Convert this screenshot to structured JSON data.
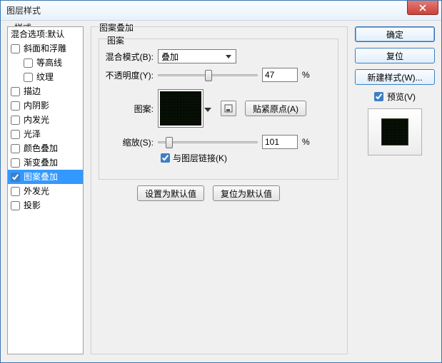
{
  "window": {
    "title": "图层样式"
  },
  "styles": {
    "panel_title": "样式",
    "blend_options": "混合选项:默认",
    "items": [
      {
        "label": "斜面和浮雕",
        "checked": false
      },
      {
        "label": "等高线",
        "checked": false,
        "indent": true
      },
      {
        "label": "纹理",
        "checked": false,
        "indent": true
      },
      {
        "label": "描边",
        "checked": false
      },
      {
        "label": "内阴影",
        "checked": false
      },
      {
        "label": "内发光",
        "checked": false
      },
      {
        "label": "光泽",
        "checked": false
      },
      {
        "label": "颜色叠加",
        "checked": false
      },
      {
        "label": "渐变叠加",
        "checked": false
      },
      {
        "label": "图案叠加",
        "checked": true,
        "selected": true
      },
      {
        "label": "外发光",
        "checked": false
      },
      {
        "label": "投影",
        "checked": false
      }
    ]
  },
  "center": {
    "group_title": "图案叠加",
    "inner_title": "图案",
    "blend_mode_label": "混合模式(B):",
    "blend_mode_value": "叠加",
    "opacity_label": "不透明度(Y):",
    "opacity_value": "47",
    "pattern_label": "图案:",
    "snap_origin_label": "贴紧原点(A)",
    "scale_label": "缩放(S):",
    "scale_value": "101",
    "link_label": "与图层链接(K)",
    "link_checked": true,
    "set_default": "设置为默认值",
    "reset_default": "复位为默认值",
    "percent": "%"
  },
  "right": {
    "ok": "确定",
    "cancel": "复位",
    "new_style": "新建样式(W)...",
    "preview_label": "预览(V)",
    "preview_checked": true
  }
}
